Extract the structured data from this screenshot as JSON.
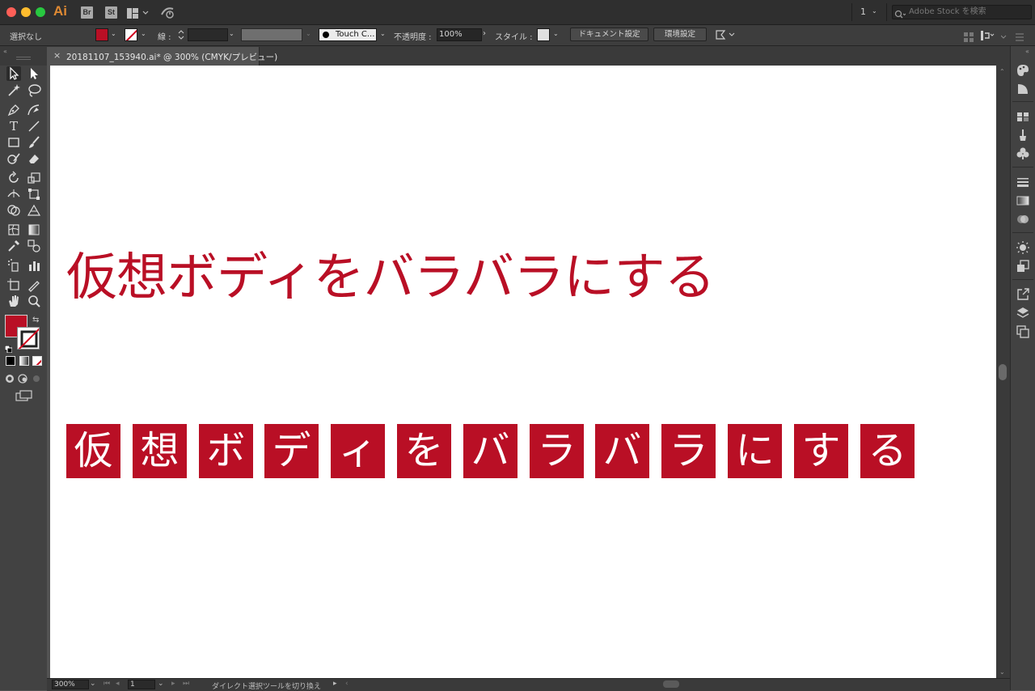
{
  "app": {
    "logo": "Ai",
    "bridge_label": "Br",
    "stock_label": "St",
    "workspace_count": "1",
    "stock_search_placeholder": "Adobe Stock を検索"
  },
  "control_bar": {
    "selection_label": "選択なし",
    "stroke_label": "線 :",
    "brush_label": "Touch C...",
    "opacity_label": "不透明度 :",
    "opacity_value": "100%",
    "style_label": "スタイル :",
    "document_setup_button": "ドキュメント設定",
    "preferences_button": "環境設定"
  },
  "document_tab": {
    "title": "20181107_153940.ai* @ 300% (CMYK/プレビュー)"
  },
  "artwork": {
    "headline": "仮想ボディをバラバラにする",
    "characters": [
      "仮",
      "想",
      "ボ",
      "デ",
      "ィ",
      "を",
      "バ",
      "ラ",
      "バ",
      "ラ",
      "に",
      "す",
      "る"
    ],
    "accent_color": "#b90f25"
  },
  "status_bar": {
    "zoom": "300%",
    "page": "1",
    "current_tool": "ダイレクト選択ツールを切り換え"
  },
  "colors": {
    "fill": "#b90f25",
    "stroke": "none"
  }
}
